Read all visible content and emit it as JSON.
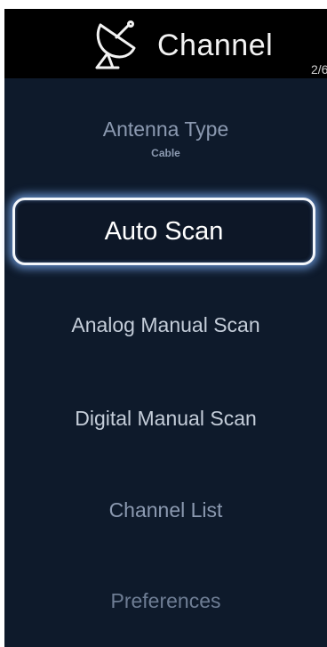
{
  "header": {
    "icon": "satellite-dish-icon",
    "title": "Channel",
    "page_indicator": "2/6"
  },
  "menu": {
    "items": [
      {
        "label": "Antenna Type",
        "value": "Cable"
      },
      {
        "label": "Auto Scan"
      },
      {
        "label": "Analog Manual Scan"
      },
      {
        "label": "Digital Manual Scan"
      },
      {
        "label": "Channel List"
      },
      {
        "label": "Preferences"
      }
    ],
    "focused_index": 1
  },
  "colors": {
    "background": "#0e1a2b",
    "header": "#000000",
    "focus_glow": "#78aaf0",
    "text": "#c4cdd9",
    "text_dim": "#8b99b0"
  }
}
